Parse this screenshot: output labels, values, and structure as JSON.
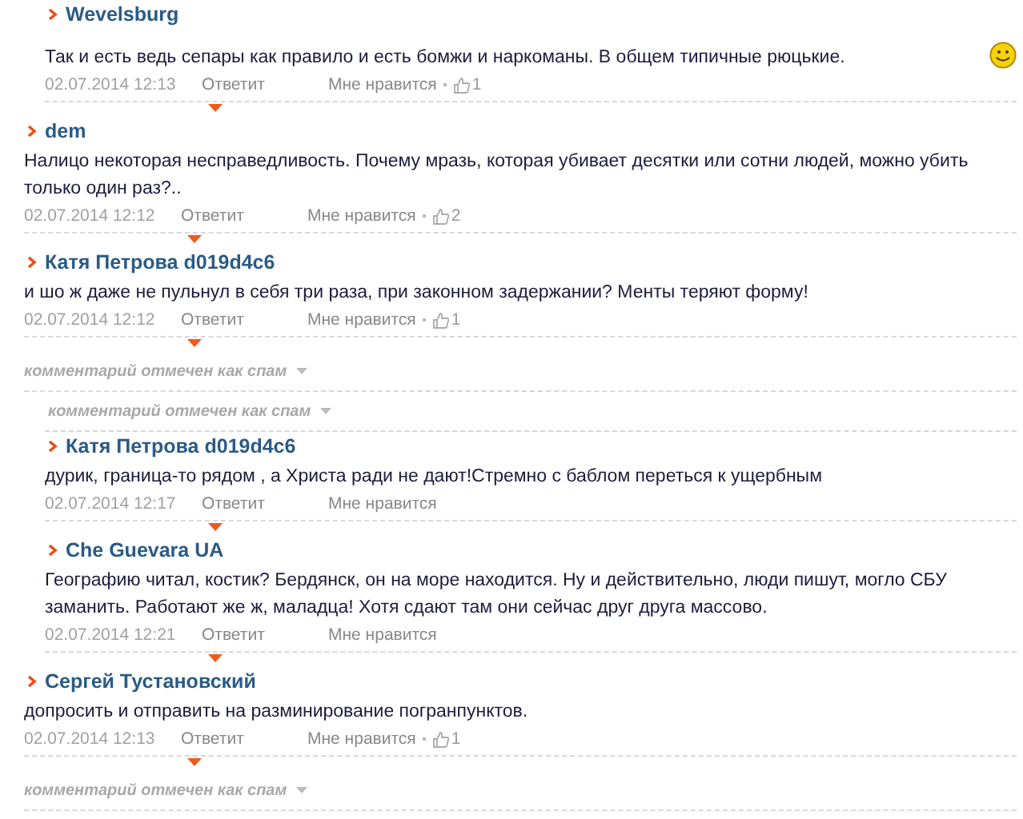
{
  "comments": [
    {
      "kind": "comment",
      "reply": true,
      "author": "Wevelsburg",
      "text": "Так и есть ведь сепары как правило и есть бомжи и наркоманы. В общем типичные рюцькие.",
      "smiley": true,
      "date": "02.07.2014 12:13",
      "reply_link": "Ответит",
      "like_link": "Мне нравится",
      "likes": "1"
    },
    {
      "kind": "comment",
      "reply": false,
      "author": "dem",
      "text": "Налицо некоторая несправедливость. Почему мразь, которая убивает десятки или сотни людей, можно убить только один раз?..",
      "smiley": false,
      "date": "02.07.2014 12:12",
      "reply_link": "Ответит",
      "like_link": "Мне нравится",
      "likes": "2"
    },
    {
      "kind": "comment",
      "reply": false,
      "author": "Катя Петрова d019d4c6",
      "text": "и шо ж даже не пульнул в себя три раза, при законном задержании? Менты теряют форму!",
      "smiley": false,
      "date": "02.07.2014 12:12",
      "reply_link": "Ответит",
      "like_link": "Мне нравится",
      "likes": "1"
    },
    {
      "kind": "spam",
      "reply": false,
      "text": "комментарий отмечен как спам"
    },
    {
      "kind": "spam",
      "reply": true,
      "text": "комментарий отмечен как спам"
    },
    {
      "kind": "comment",
      "reply": true,
      "author": "Катя Петрова d019d4c6",
      "text": "дурик, граница-то рядом , а Христа ради не дают!Стремно с баблом переться к ущербным",
      "smiley": false,
      "date": "02.07.2014 12:17",
      "reply_link": "Ответит",
      "like_link": "Мне нравится"
    },
    {
      "kind": "comment",
      "reply": true,
      "author": "Che Guevara UA",
      "text": "Географию читал, костик? Бердянск, он на море находится. Ну и действительно, люди пишут, могло СБУ заманить. Работают же ж, маладца! Хотя сдают там они сейчас друг друга массово.",
      "smiley": false,
      "date": "02.07.2014 12:21",
      "reply_link": "Ответит",
      "like_link": "Мне нравится"
    },
    {
      "kind": "comment",
      "reply": false,
      "author": "Сергей Тустановский",
      "text": "допросить и отправить на разминирование погранпунктов.",
      "smiley": false,
      "date": "02.07.2014 12:13",
      "reply_link": "Ответит",
      "like_link": "Мне нравится",
      "likes": "1"
    },
    {
      "kind": "spam",
      "reply": false,
      "text": "комментарий отмечен как спам"
    }
  ]
}
